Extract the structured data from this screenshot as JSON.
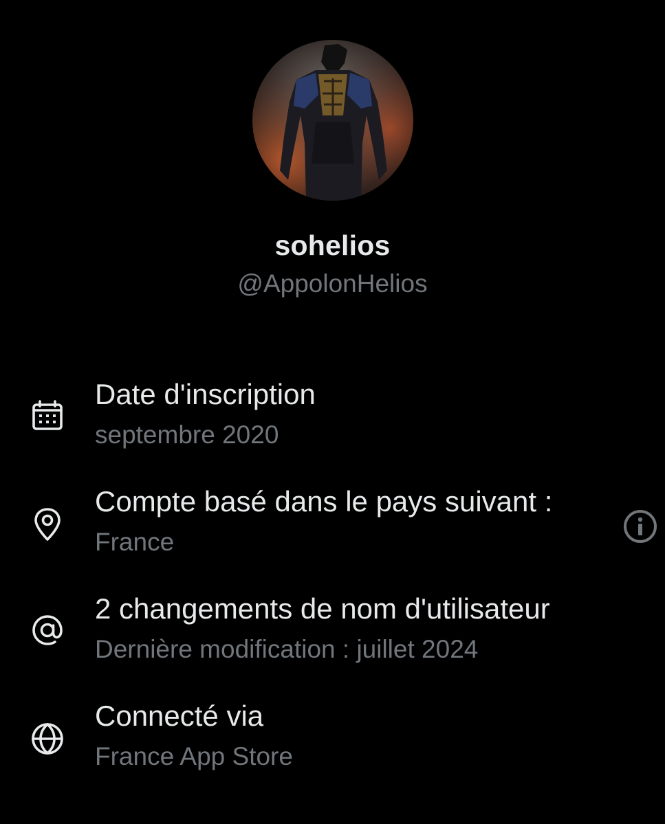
{
  "profile": {
    "display_name": "sohelios",
    "handle": "@AppolonHelios"
  },
  "details": [
    {
      "icon": "calendar-icon",
      "title": "Date d'inscription",
      "subtitle": "septembre 2020"
    },
    {
      "icon": "location-pin-icon",
      "title": "Compte basé dans le pays suivant :",
      "subtitle": "France",
      "extra_icon": "info-icon"
    },
    {
      "icon": "at-sign-icon",
      "title": "2 changements de nom d'utilisateur",
      "subtitle": "Dernière modification : juillet 2024"
    },
    {
      "icon": "globe-icon",
      "title": "Connecté via",
      "subtitle": "France App Store"
    }
  ],
  "colors": {
    "background": "#000000",
    "primary_text": "#e7e9ea",
    "secondary_text": "#71767b"
  }
}
